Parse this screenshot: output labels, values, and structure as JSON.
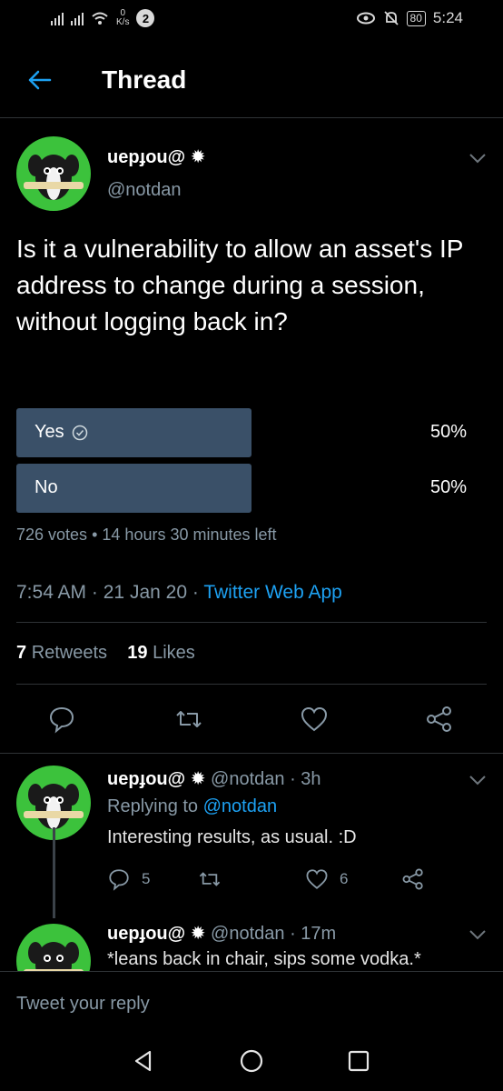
{
  "status_bar": {
    "speed_value": "0",
    "speed_unit": "K/s",
    "notification_count": "2",
    "battery": "80",
    "time": "5:24"
  },
  "header": {
    "title": "Thread"
  },
  "tweet": {
    "display_name": "uepɟou@",
    "handle": "@notdan",
    "text": "Is it a vulnerability to allow an asset's IP address to change during a session, without logging back in?",
    "poll": {
      "options": [
        {
          "label": "Yes",
          "percent": "50%",
          "fraction": 0.5
        },
        {
          "label": "No",
          "percent": "50%",
          "fraction": 0.5
        }
      ],
      "votes": "726 votes",
      "separator": "•",
      "time_left": "14 hours 30 minutes left"
    },
    "time": "7:54 AM",
    "date": "21 Jan 20",
    "dot": "·",
    "source": "Twitter Web App",
    "retweet_count": "7",
    "retweet_label": "Retweets",
    "like_count": "19",
    "like_label": "Likes"
  },
  "replies": [
    {
      "display_name": "uepɟou@",
      "handle": "@notdan",
      "age": "· 3h",
      "replying_prefix": "Replying to",
      "replying_handle": "@notdan",
      "text": "Interesting results, as usual. :D",
      "reply_count": "5",
      "retweet_count": "",
      "like_count": "6"
    },
    {
      "display_name": "uepɟou@",
      "handle": "@notdan",
      "age": "· 17m",
      "text": "*leans back in chair, sips some vodka.*"
    }
  ],
  "reply_bar": {
    "placeholder": "Tweet your reply"
  },
  "colors": {
    "accent": "#1da1f2",
    "poll_bar": "#3a5068",
    "avatar_bg": "#3cc23c",
    "muted": "#8899a6"
  }
}
